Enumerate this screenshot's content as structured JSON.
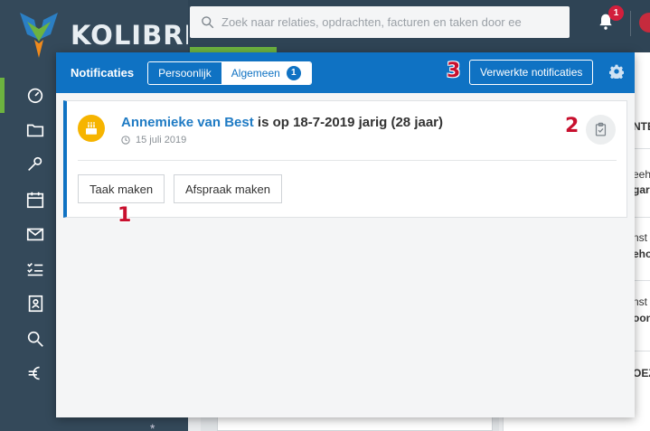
{
  "app": {
    "logo_text": "KOLIBRI"
  },
  "search": {
    "placeholder": "Zoek naar relaties, opdrachten, facturen en taken door ee"
  },
  "header": {
    "notification_count": "1"
  },
  "notifications_panel": {
    "title": "Notificaties",
    "tabs": [
      {
        "label": "Persoonlijk",
        "active": false
      },
      {
        "label": "Algemeen",
        "active": true,
        "count": "1"
      }
    ],
    "processed_button": "Verwerkte notificaties",
    "items": [
      {
        "name": "Annemieke van Best",
        "message": "is op 18-7-2019 jarig (28 jaar)",
        "date": "15 juli 2019",
        "actions": [
          "Taak maken",
          "Afspraak maken"
        ]
      }
    ]
  },
  "callouts": [
    "1",
    "2",
    "3"
  ],
  "background_right": {
    "rows": [
      "NTE",
      "eeh",
      "gar",
      "nst",
      "eho",
      "nst",
      "oon",
      "OEZ"
    ]
  },
  "colors": {
    "primary": "#0f72c3",
    "sidebar": "#34495a",
    "accent_green": "#6db33f",
    "badge_red": "#d21f3c",
    "callout_red": "#c8102e",
    "cake_yellow": "#f6b400"
  }
}
